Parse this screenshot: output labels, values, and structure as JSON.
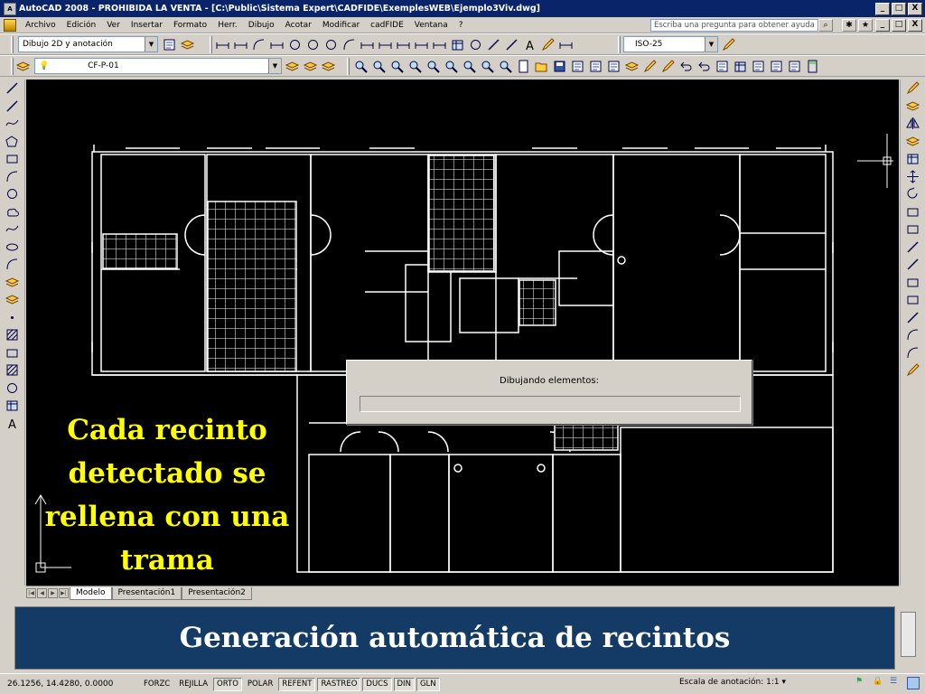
{
  "window": {
    "title": "AutoCAD 2008 - PROHIBIDA LA VENTA - [C:\\Public\\Sistema Expert\\CADFIDE\\ExemplesWEB\\Ejemplo3Viv.dwg]",
    "buttons": [
      "_",
      "□",
      "X"
    ]
  },
  "menubar": {
    "items": [
      "Archivo",
      "Edición",
      "Ver",
      "Insertar",
      "Formato",
      "Herr.",
      "Dibujo",
      "Acotar",
      "Modificar",
      "cadFIDE",
      "Ventana",
      "?"
    ],
    "help_placeholder": "Escriba una pregunta para obtener ayuda"
  },
  "toolbar": {
    "workspace": "Dibujo 2D y anotación",
    "dimstyle": "ISO-25",
    "layer": "CF-P-01"
  },
  "canvas": {
    "background": "#000000",
    "overlay_text": [
      "Cada recinto",
      "detectado se",
      "rellena con una",
      "trama"
    ]
  },
  "dialog": {
    "message": "Dibujando elementos:",
    "progress": 0.0
  },
  "tabs": {
    "items": [
      "Modelo",
      "Presentación1",
      "Presentación2"
    ],
    "active": "Modelo"
  },
  "banner": {
    "text": "Generación automática de recintos",
    "color": "#143a66"
  },
  "statusbar": {
    "coords": "26.1256, 14.4280, 0.0000",
    "toggles": [
      {
        "label": "FORZC",
        "on": false
      },
      {
        "label": "REJILLA",
        "on": false
      },
      {
        "label": "ORTO",
        "on": true
      },
      {
        "label": "POLAR",
        "on": false
      },
      {
        "label": "REFENT",
        "on": true
      },
      {
        "label": "RASTREO",
        "on": true
      },
      {
        "label": "DUCS",
        "on": true
      },
      {
        "label": "DIN",
        "on": true
      },
      {
        "label": "GLN",
        "on": true
      }
    ],
    "scale_label": "Escala de anotación:",
    "scale_value": "1:1 ▾"
  }
}
